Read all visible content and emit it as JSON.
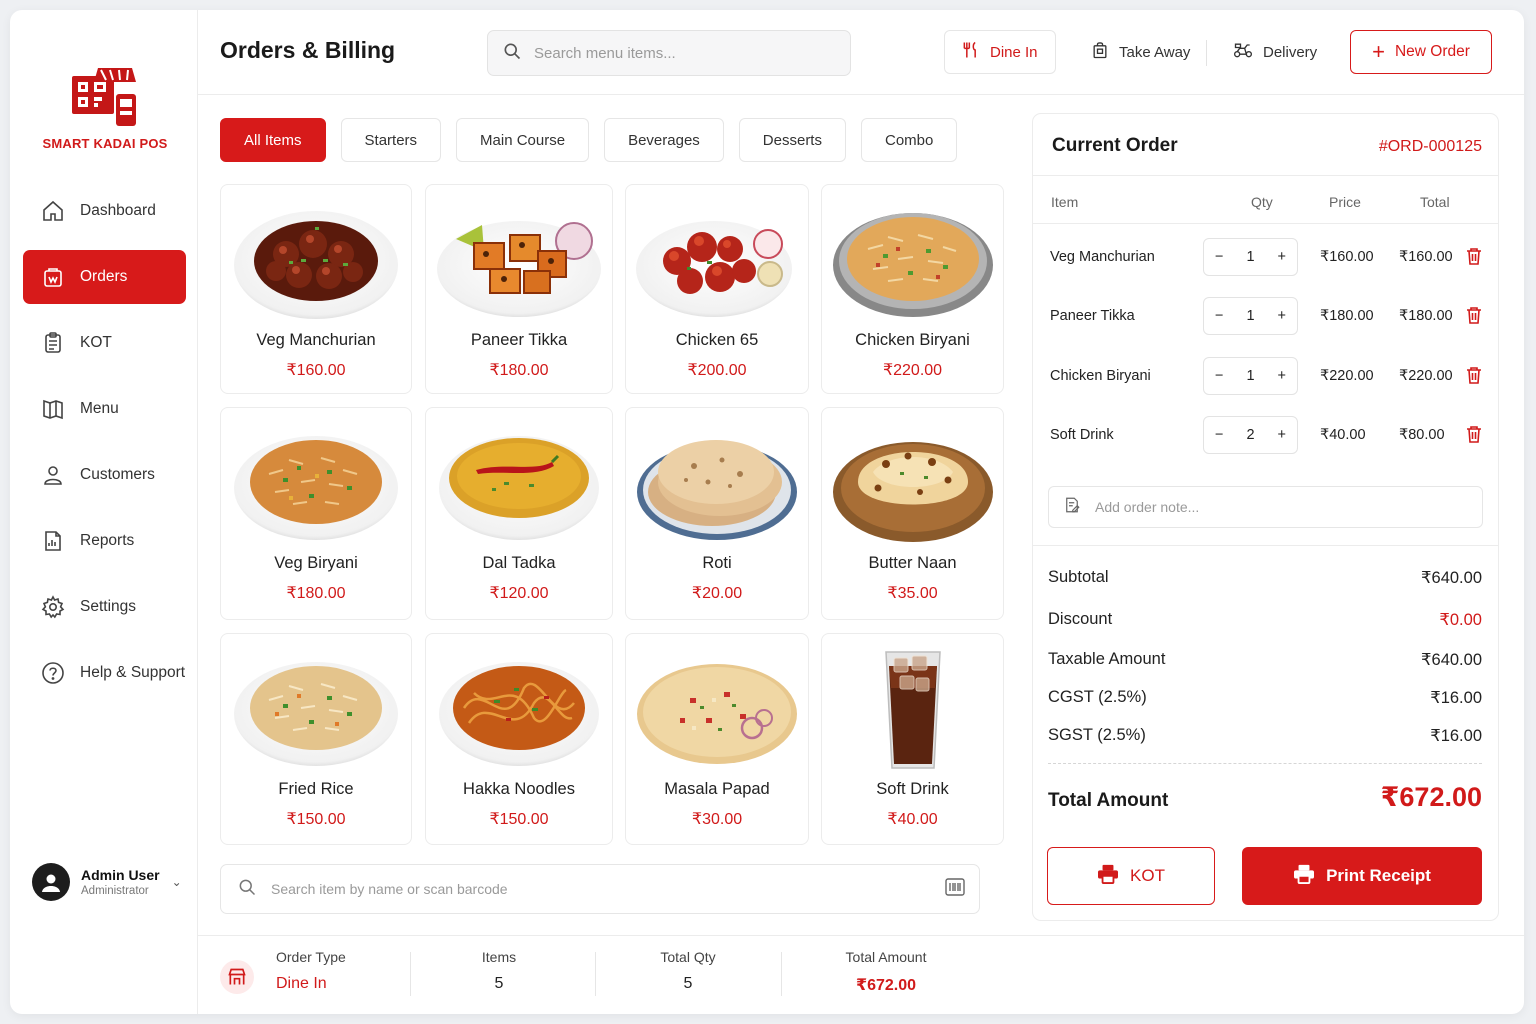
{
  "brand": {
    "name": "SMART KADAI POS"
  },
  "colors": {
    "accent": "#d71a1a",
    "accent_text": "#d11a1a"
  },
  "sidebar": {
    "items": [
      {
        "label": "Dashboard",
        "icon": "home-icon",
        "active": false
      },
      {
        "label": "Orders",
        "icon": "orders-icon",
        "active": true
      },
      {
        "label": "KOT",
        "icon": "clipboard-icon",
        "active": false
      },
      {
        "label": "Menu",
        "icon": "menu-book-icon",
        "active": false
      },
      {
        "label": "Customers",
        "icon": "user-icon",
        "active": false
      },
      {
        "label": "Reports",
        "icon": "report-icon",
        "active": false
      },
      {
        "label": "Settings",
        "icon": "gear-icon",
        "active": false
      },
      {
        "label": "Help & Support",
        "icon": "help-icon",
        "active": false
      }
    ],
    "user": {
      "name": "Admin User",
      "role": "Administrator"
    }
  },
  "header": {
    "title": "Orders & Billing",
    "search_placeholder": "Search menu items...",
    "order_types": {
      "dine_in": "Dine In",
      "take_away": "Take Away",
      "delivery": "Delivery"
    },
    "new_order_label": "New Order"
  },
  "categories": [
    "All Items",
    "Starters",
    "Main Course",
    "Beverages",
    "Desserts",
    "Combo"
  ],
  "menu": [
    {
      "name": "Veg Manchurian",
      "price": "₹160.00",
      "icon": "veg-manchurian-dish"
    },
    {
      "name": "Paneer Tikka",
      "price": "₹180.00",
      "icon": "paneer-tikka-dish"
    },
    {
      "name": "Chicken 65",
      "price": "₹200.00",
      "icon": "chicken-65-dish"
    },
    {
      "name": "Chicken Biryani",
      "price": "₹220.00",
      "icon": "chicken-biryani-dish"
    },
    {
      "name": "Veg Biryani",
      "price": "₹180.00",
      "icon": "veg-biryani-dish"
    },
    {
      "name": "Dal Tadka",
      "price": "₹120.00",
      "icon": "dal-tadka-dish"
    },
    {
      "name": "Roti",
      "price": "₹20.00",
      "icon": "roti-dish"
    },
    {
      "name": "Butter Naan",
      "price": "₹35.00",
      "icon": "butter-naan-dish"
    },
    {
      "name": "Fried Rice",
      "price": "₹150.00",
      "icon": "fried-rice-dish"
    },
    {
      "name": "Hakka Noodles",
      "price": "₹150.00",
      "icon": "hakka-noodles-dish"
    },
    {
      "name": "Masala Papad",
      "price": "₹30.00",
      "icon": "masala-papad-dish"
    },
    {
      "name": "Soft Drink",
      "price": "₹40.00",
      "icon": "soft-drink-glass"
    }
  ],
  "bottom_search": {
    "placeholder": "Search item by name or scan barcode"
  },
  "footer": {
    "order_type_label": "Order Type",
    "order_type_value": "Dine In",
    "items_label": "Items",
    "items_value": "5",
    "total_qty_label": "Total Qty",
    "total_qty_value": "5",
    "total_amount_label": "Total Amount",
    "total_amount_value": "₹672.00"
  },
  "order": {
    "title": "Current Order",
    "id": "#ORD-000125",
    "headers": {
      "item": "Item",
      "qty": "Qty",
      "price": "Price",
      "total": "Total"
    },
    "lines": [
      {
        "name": "Veg Manchurian",
        "qty": "1",
        "price": "₹160.00",
        "total": "₹160.00"
      },
      {
        "name": "Paneer Tikka",
        "qty": "1",
        "price": "₹180.00",
        "total": "₹180.00"
      },
      {
        "name": "Chicken Biryani",
        "qty": "1",
        "price": "₹220.00",
        "total": "₹220.00"
      },
      {
        "name": "Soft Drink",
        "qty": "2",
        "price": "₹40.00",
        "total": "₹80.00"
      }
    ],
    "note_placeholder": "Add order note...",
    "summary": {
      "subtotal_label": "Subtotal",
      "subtotal": "₹640.00",
      "discount_label": "Discount",
      "discount": "₹0.00",
      "taxable_label": "Taxable Amount",
      "taxable": "₹640.00",
      "cgst_label": "CGST (2.5%)",
      "cgst": "₹16.00",
      "sgst_label": "SGST (2.5%)",
      "sgst": "₹16.00",
      "total_label": "Total Amount",
      "total": "₹672.00"
    },
    "kot_label": "KOT",
    "print_label": "Print Receipt"
  }
}
